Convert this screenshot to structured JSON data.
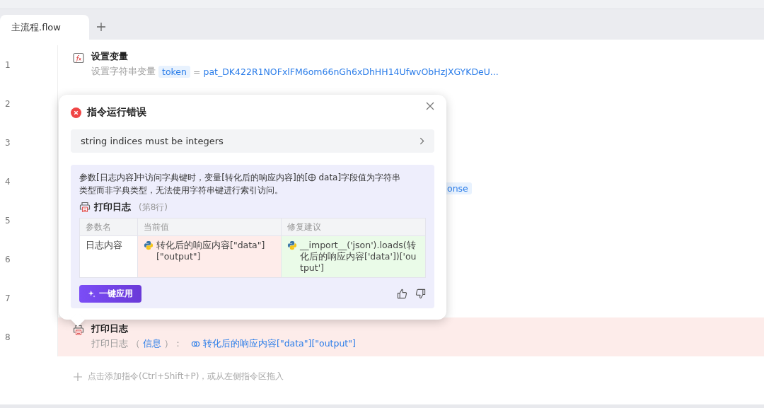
{
  "tabs": [
    {
      "label": "主流程.flow",
      "selected": true
    }
  ],
  "lines": [
    {
      "number": "1",
      "kind": "set_variable",
      "error": false,
      "title": "设置变量",
      "desc": "设置字符串变量",
      "var": "token",
      "op": "=",
      "value": "pat_DK422R1NOFxlFM6om66nGh6xDhHH14UfwvObHzJXGYKDeU..."
    },
    {
      "number": "2",
      "kind": "covered",
      "error": false
    },
    {
      "number": "3",
      "kind": "covered",
      "error": false
    },
    {
      "number": "4",
      "kind": "covered",
      "error": false,
      "tag": "onse"
    },
    {
      "number": "5",
      "kind": "covered",
      "error": false
    },
    {
      "number": "6",
      "kind": "covered",
      "error": false
    },
    {
      "number": "7",
      "kind": "covered",
      "error": false
    },
    {
      "number": "8",
      "kind": "print_log",
      "error": true,
      "title": "打印日志",
      "desc": "打印日志",
      "open": "（",
      "param": "信息",
      "close": "）：",
      "value": "转化后的响应内容[\"data\"][\"output\"]"
    }
  ],
  "add_hint": "点击添加指令(Ctrl+Shift+P)，或从左侧指令区拖入",
  "error_popup": {
    "title": "指令运行错误",
    "message": "string indices must be integers",
    "explanation_before": "参数[日志内容]中访问字典键时，变量[转化后的响应内容]的[",
    "explanation_after": "data]字段值为字符串",
    "explanation_line_2": "类型而非字典类型，无法使用字符串键进行索引访问。",
    "command": "打印日志",
    "command_line": "(第8行)",
    "columns": [
      "参数名",
      "当前值",
      "修复建议"
    ],
    "rows": [
      {
        "param": "日志内容",
        "current": "转化后的响应内容[\"data\"][\"output\"]",
        "fix": "__import__('json').loads(转化后的响应内容['data'])['output']"
      }
    ],
    "apply_button": "一键应用"
  }
}
